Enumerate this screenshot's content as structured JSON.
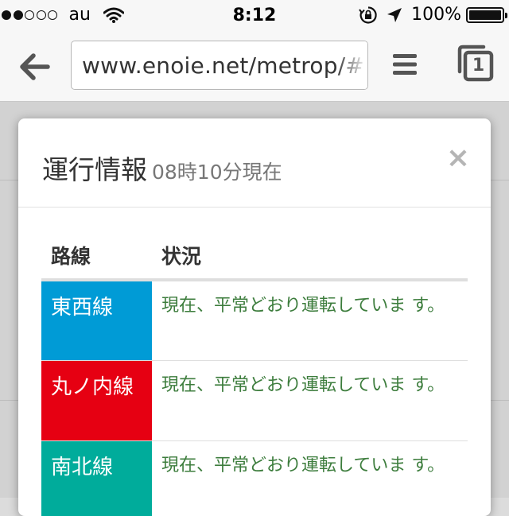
{
  "statusbar": {
    "carrier": "au",
    "time": "8:12",
    "battery_percent": "100%",
    "signal_bars_filled": 2,
    "signal_bars_total": 5
  },
  "browser": {
    "url": "www.enoie.net/metrop/#",
    "tab_count": "1"
  },
  "modal": {
    "title": "運行情報",
    "subtitle": "08時10分現在",
    "close_label": "×",
    "table": {
      "headers": [
        "路線",
        "状況"
      ],
      "rows": [
        {
          "line": "東西線",
          "status": "現在、平常どおり運転していま す。",
          "color": "#009bd6"
        },
        {
          "line": "丸ノ内線",
          "status": "現在、平常どおり運転していま す。",
          "color": "#e60012"
        },
        {
          "line": "南北線",
          "status": "現在、平常どおり運転していま す。",
          "color": "#00ac9b"
        }
      ]
    }
  },
  "colors": {
    "status_text": "#3d7d3d"
  }
}
